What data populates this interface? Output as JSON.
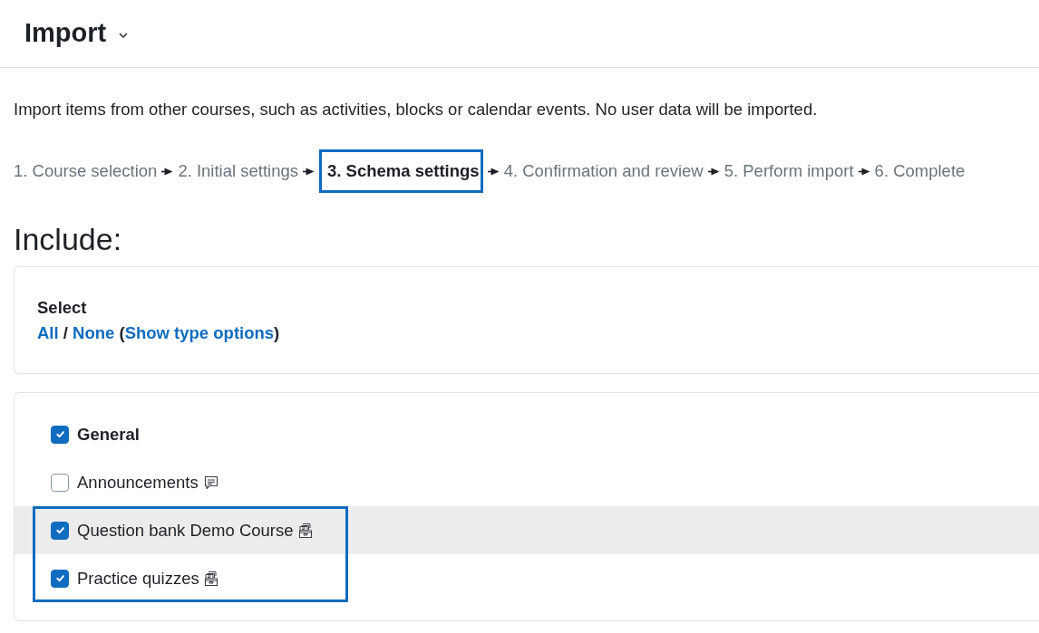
{
  "header": {
    "title": "Import"
  },
  "description": "Import items from other courses, such as activities, blocks or calendar events. No user data will be imported.",
  "steps": [
    {
      "label": "1. Course selection",
      "selected": false,
      "highlighted": false
    },
    {
      "label": "2. Initial settings",
      "selected": false,
      "highlighted": false
    },
    {
      "label": "3. Schema settings",
      "selected": true,
      "highlighted": true
    },
    {
      "label": "4. Confirmation and review",
      "selected": false,
      "highlighted": false
    },
    {
      "label": "5. Perform import",
      "selected": false,
      "highlighted": false
    },
    {
      "label": "6. Complete",
      "selected": false,
      "highlighted": false
    }
  ],
  "include": {
    "heading": "Include:",
    "select": {
      "label": "Select",
      "parts": [
        {
          "kind": "link",
          "text": "All"
        },
        {
          "kind": "text",
          "text": " / "
        },
        {
          "kind": "link",
          "text": "None"
        },
        {
          "kind": "text",
          "text": " ("
        },
        {
          "kind": "link",
          "text": "Show type options"
        },
        {
          "kind": "text",
          "text": ")"
        }
      ]
    },
    "items": [
      {
        "kind": "section",
        "label": "General",
        "checked": true,
        "hovered": false,
        "highlighted": false
      },
      {
        "kind": "forum",
        "label": "Announcements",
        "checked": false,
        "hovered": false,
        "highlighted": false
      },
      {
        "kind": "qbank",
        "label": "Question bank Demo Course",
        "checked": true,
        "hovered": true,
        "highlighted": true
      },
      {
        "kind": "quiz",
        "label": "Practice quizzes",
        "checked": true,
        "hovered": false,
        "highlighted": true
      }
    ]
  }
}
